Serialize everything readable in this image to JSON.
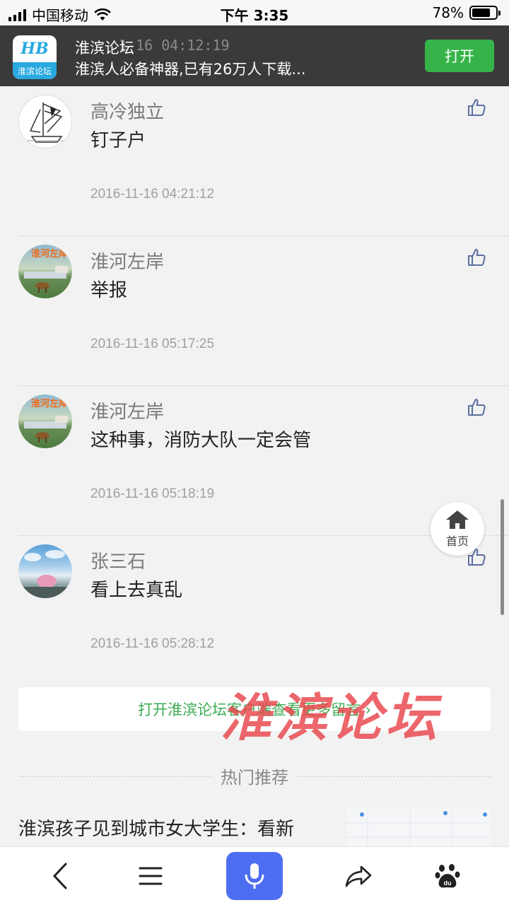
{
  "status_bar": {
    "carrier": "中国移动",
    "time": "下午 3:35",
    "battery_percent": "78%",
    "battery_level": 0.78
  },
  "app_banner": {
    "logo_mark": "HB",
    "logo_text": "淮滨论坛",
    "title": "淮滨论坛",
    "subtitle": "淮滨人必备神器,已有26万人下载...",
    "ghost_time": "1-16 04:12:19",
    "open_label": "打开"
  },
  "comments": [
    {
      "name": "高冷独立",
      "text": "钉子户",
      "time": "2016-11-16 04:21:12",
      "avatar": "sailboat-sketch-avatar"
    },
    {
      "name": "淮河左岸",
      "text": "举报",
      "time": "2016-11-16 05:17:25",
      "avatar": "river-landscape-avatar",
      "avatar_tag": "淮河左岸"
    },
    {
      "name": "淮河左岸",
      "text": "这种事，消防大队一定会管",
      "time": "2016-11-16 05:18:19",
      "avatar": "river-landscape-avatar",
      "avatar_tag": "淮河左岸"
    },
    {
      "name": "张三石",
      "text": "看上去真乱",
      "time": "2016-11-16 05:28:12",
      "avatar": "sky-landscape-avatar"
    }
  ],
  "home_button": {
    "label": "首页"
  },
  "open_client": {
    "label": "打开淮滨论坛客户端查看更多留言 ›"
  },
  "watermark": {
    "text": "淮滨论坛"
  },
  "hot": {
    "label": "热门推荐",
    "items": [
      {
        "title": "淮滨孩子见到城市女大学生：看新"
      }
    ]
  },
  "bottom_nav": {
    "back": "back-icon",
    "menu": "menu-icon",
    "voice": "microphone-icon",
    "share": "share-icon",
    "baidu": "baidu-paw-icon"
  },
  "colors": {
    "banner_bg": "#3a3a3a",
    "open_button": "#36b44a",
    "link_green": "#3dab52",
    "mic_blue": "#4e6ef2",
    "watermark_red": "#e8444b"
  }
}
